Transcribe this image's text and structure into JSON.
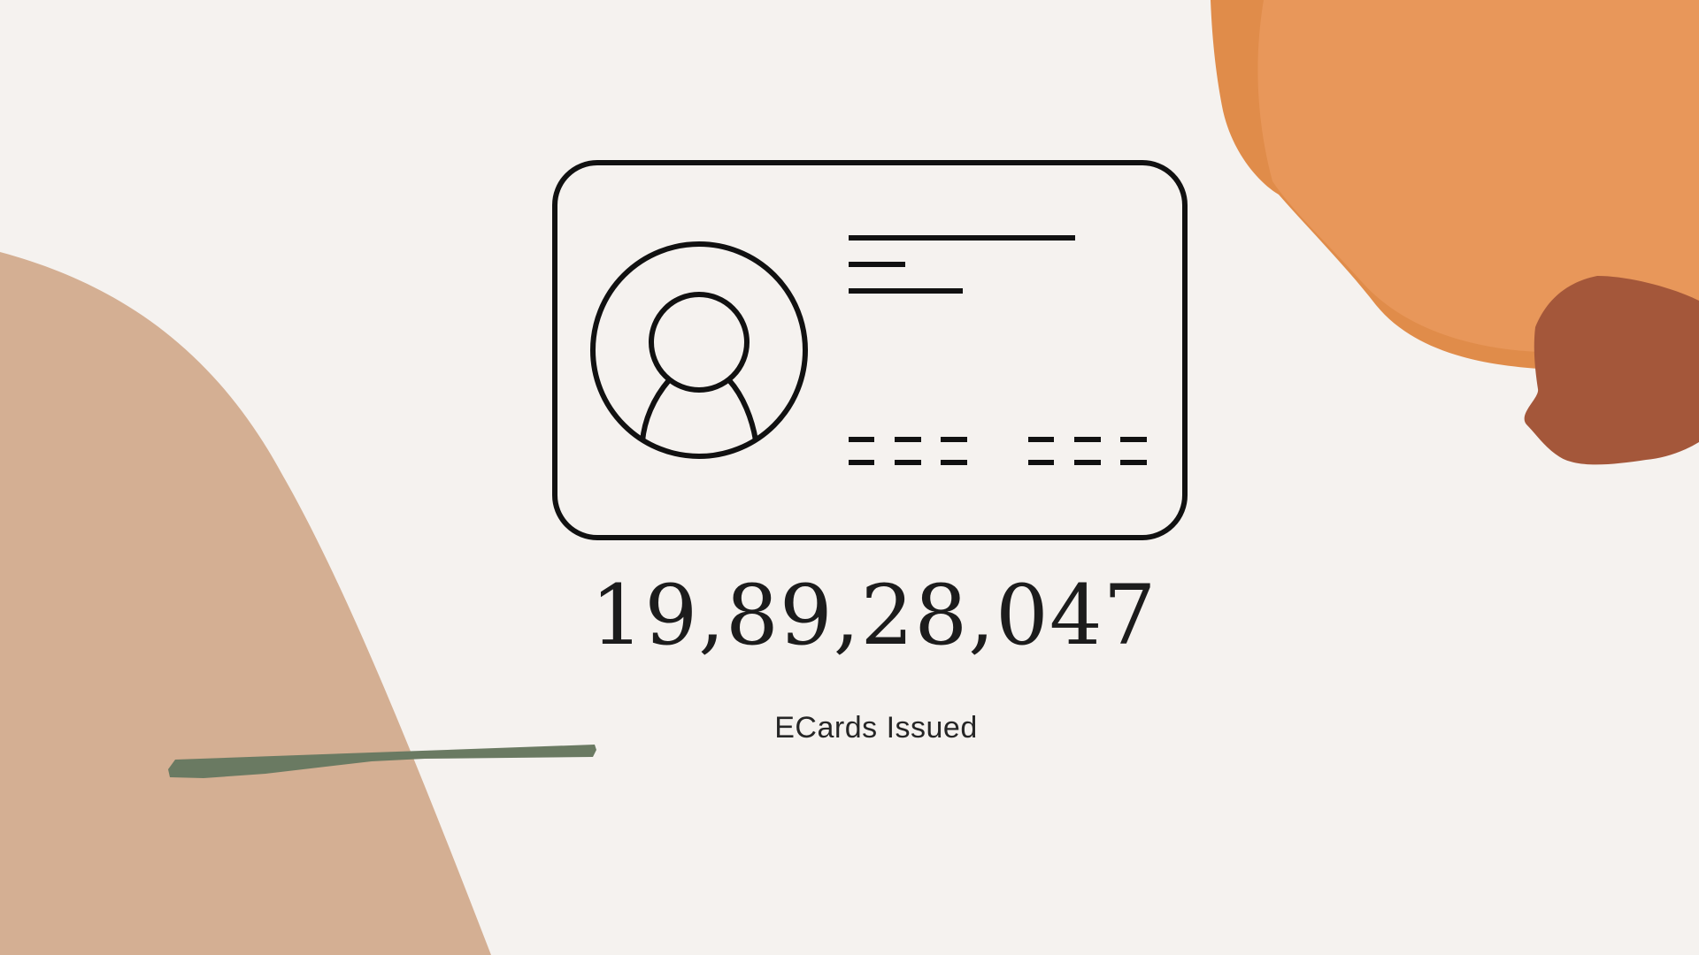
{
  "stat": {
    "value": "19,89,28,047",
    "label": "ECards Issued"
  },
  "icon": {
    "name": "id-card-icon",
    "stroke_color": "#111111"
  },
  "colors": {
    "background": "#f5f2ef",
    "tan_blob": "#d4af93",
    "orange_blob": "#e8975a",
    "orange_blob_shadow": "#e08c4a",
    "rust_blob": "#a4573a",
    "green_stroke": "#6a7a62",
    "text": "#1c1c1c"
  }
}
